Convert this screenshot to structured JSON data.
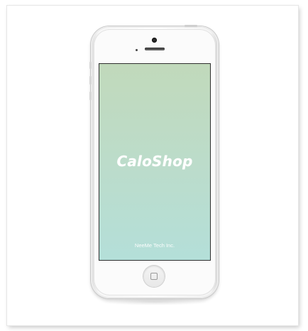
{
  "splash": {
    "app_name": "CaloShop",
    "company": "NeeMe Tech Inc."
  },
  "colors": {
    "screen_top": "#c1d9bb",
    "screen_bottom": "#b4dfd9",
    "text": "#ffffff"
  },
  "icons": {
    "home_button": "home-button-icon",
    "camera": "front-camera-icon",
    "speaker": "speaker-grille-icon"
  }
}
